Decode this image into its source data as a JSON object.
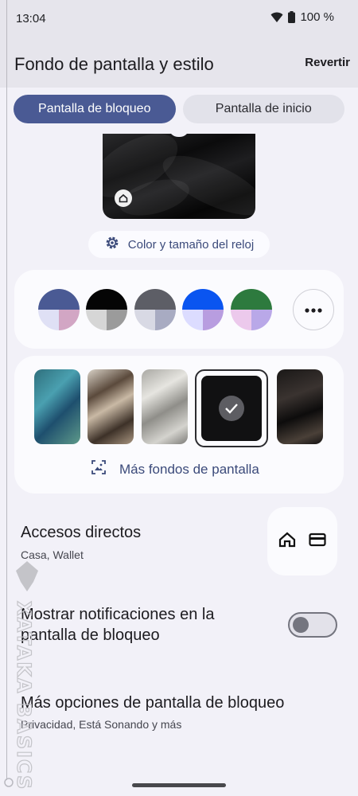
{
  "status_bar": {
    "time": "13:04",
    "battery": "100 %"
  },
  "header": {
    "title": "Fondo de pantalla y estilo",
    "revert_label": "Revertir"
  },
  "tabs": [
    {
      "label": "Pantalla de bloqueo",
      "active": true
    },
    {
      "label": "Pantalla de inicio",
      "active": false
    }
  ],
  "preview": {
    "clock_button_label": "Color y tamaño del reloj"
  },
  "colors": {
    "swatches": [
      {
        "top": "#4a5a94",
        "bottom_left": "#dfe0f5",
        "bottom_right": "#d2a6c4"
      },
      {
        "top": "#050505",
        "bottom_left": "#d6d6d6",
        "bottom_right": "#9b9b9b"
      },
      {
        "top": "#5d5e66",
        "bottom_left": "#d8d9e4",
        "bottom_right": "#a8abc2"
      },
      {
        "top": "#0a55f0",
        "bottom_left": "#dcdcff",
        "bottom_right": "#b89de0"
      },
      {
        "top": "#2d7a3e",
        "bottom_left": "#ecc9ec",
        "bottom_right": "#b9a8e8"
      }
    ],
    "more_icon": "more-horiz-icon"
  },
  "wallpapers": {
    "more_label": "Más fondos de pantalla"
  },
  "shortcuts": {
    "title": "Accesos directos",
    "subtitle": "Casa, Wallet"
  },
  "notifications": {
    "title_line1": "Mostrar notificaciones en la",
    "title_line2": "pantalla de bloqueo",
    "enabled": false
  },
  "more_options": {
    "title": "Más opciones de pantalla de bloqueo",
    "subtitle": "Privacidad, Está Sonando y más"
  },
  "watermark": {
    "text": "XATAKA BASICS"
  }
}
